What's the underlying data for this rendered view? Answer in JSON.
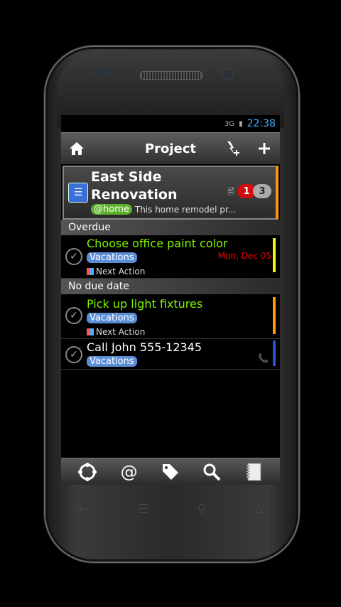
{
  "status": {
    "network": "3G",
    "time": "22:38"
  },
  "actionbar": {
    "title": "Project",
    "home_icon": "home-icon",
    "add_icon": "plus-icon"
  },
  "project": {
    "title": "East Side Renovation",
    "context_tag": "@home",
    "description": "This home remodel pr...",
    "badge_overdue": "1",
    "badge_count": "3",
    "accent": "#ff9900"
  },
  "sections": [
    {
      "label": "Overdue"
    },
    {
      "label": "No due date"
    }
  ],
  "tasks": [
    {
      "title": "Choose office paint color",
      "tag": "Vacations",
      "status": "Next Action",
      "due": "Mon, Dec 05",
      "bar_color": "#f5f500"
    },
    {
      "title": "Pick up light fixtures",
      "tag": "Vacations",
      "status": "Next Action",
      "bar_color": "#ff9900"
    },
    {
      "title": "Call John 555-12345",
      "tag": "Vacations",
      "bar_color": "#2a4fd8"
    }
  ],
  "bottombar": {
    "icons": [
      "projects-icon",
      "contexts-icon",
      "tags-icon",
      "search-icon",
      "notebook-icon"
    ]
  },
  "navkeys": [
    "back-icon",
    "menu-icon",
    "search-icon",
    "home-icon"
  ]
}
